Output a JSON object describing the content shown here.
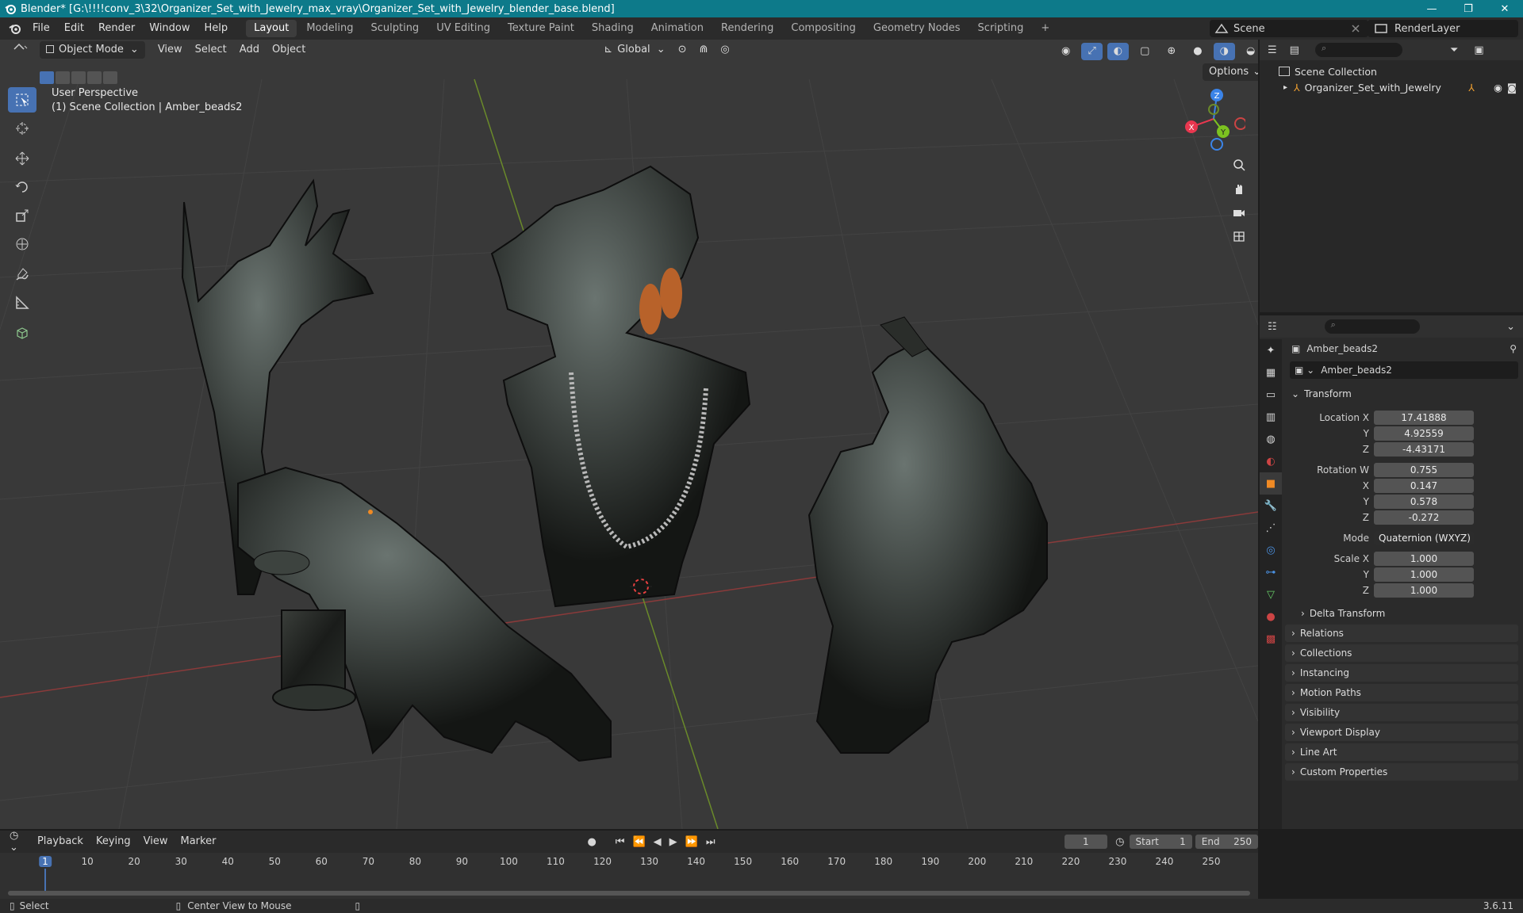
{
  "window": {
    "title": "Blender* [G:\\!!!!conv_3\\32\\Organizer_Set_with_Jewelry_max_vray\\Organizer_Set_with_Jewelry_blender_base.blend]",
    "minimize": "—",
    "maximize": "❐",
    "close": "✕"
  },
  "menu": [
    "File",
    "Edit",
    "Render",
    "Window",
    "Help"
  ],
  "workspaces": [
    "Layout",
    "Modeling",
    "Sculpting",
    "UV Editing",
    "Texture Paint",
    "Shading",
    "Animation",
    "Rendering",
    "Compositing",
    "Geometry Nodes",
    "Scripting"
  ],
  "workspace_add": "+",
  "scene_name": "Scene",
  "render_layer": "RenderLayer",
  "viewport": {
    "mode": "Object Mode",
    "menus": [
      "View",
      "Select",
      "Add",
      "Object"
    ],
    "transform_orientation": "Global",
    "options_label": "Options",
    "perspective_label": "User Perspective",
    "context_label": "(1) Scene Collection | Amber_beads2",
    "gizmo_axes": {
      "x": "X",
      "y": "Y",
      "z": "Z"
    }
  },
  "outliner": {
    "root": "Scene Collection",
    "items": [
      "Organizer_Set_with_Jewelry"
    ]
  },
  "properties": {
    "object_name": "Amber_beads2",
    "data_name": "Amber_beads2",
    "transform_title": "Transform",
    "location": {
      "label": "Location X",
      "x": "17.41888",
      "y": "4.92559",
      "z": "-4.43171"
    },
    "rotation": {
      "label": "Rotation W",
      "w": "0.755",
      "x": "0.147",
      "y": "0.578",
      "z": "-0.272"
    },
    "mode_label": "Mode",
    "mode_value": "Quaternion (WXYZ)",
    "scale": {
      "label": "Scale X",
      "x": "1.000",
      "y": "1.000",
      "z": "1.000"
    },
    "axis_labels": {
      "y": "Y",
      "z": "Z",
      "x": "X"
    },
    "delta": "Delta Transform",
    "panels": [
      "Relations",
      "Collections",
      "Instancing",
      "Motion Paths",
      "Visibility",
      "Viewport Display",
      "Line Art",
      "Custom Properties"
    ]
  },
  "timeline": {
    "menus": [
      "Playback",
      "Keying",
      "View",
      "Marker"
    ],
    "current_frame": "1",
    "start_label": "Start",
    "start": "1",
    "end_label": "End",
    "end": "250",
    "ticks": [
      "1",
      "10",
      "20",
      "30",
      "40",
      "50",
      "60",
      "70",
      "80",
      "90",
      "100",
      "110",
      "120",
      "130",
      "140",
      "150",
      "160",
      "170",
      "180",
      "190",
      "200",
      "210",
      "220",
      "230",
      "240",
      "250"
    ]
  },
  "status": {
    "select": "Select",
    "center": "Center View to Mouse",
    "version": "3.6.11"
  },
  "colors": {
    "titlebar": "#0d7a8a",
    "accent": "#4772b3",
    "axis_x": "#e8374f",
    "axis_y": "#7cc220",
    "axis_z": "#3b84e8"
  }
}
